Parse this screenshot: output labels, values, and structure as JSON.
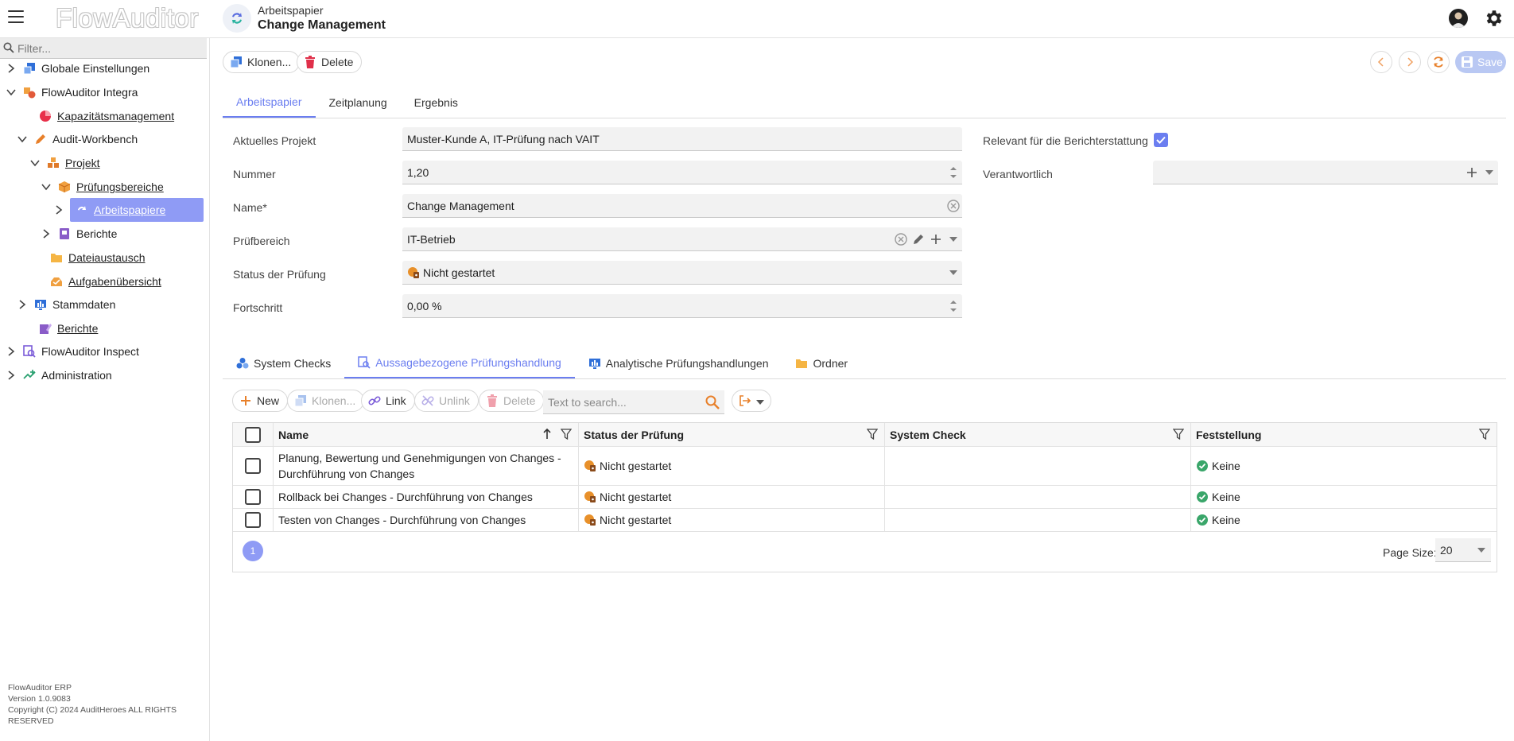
{
  "app": {
    "logo": "FlowAuditor"
  },
  "header": {
    "subtitle": "Arbeitspapier",
    "title": "Change Management"
  },
  "sidebar": {
    "filter_placeholder": "Filter...",
    "items": [
      {
        "label": "Globale Einstellungen"
      },
      {
        "label": "FlowAuditor Integra"
      },
      {
        "label": "Kapazitätsmanagement"
      },
      {
        "label": "Audit-Workbench"
      },
      {
        "label": "Projekt"
      },
      {
        "label": "Prüfungsbereiche"
      },
      {
        "label": "Arbeitspapiere"
      },
      {
        "label": "Berichte"
      },
      {
        "label": "Dateiaustausch"
      },
      {
        "label": "Aufgabenübersicht"
      },
      {
        "label": "Stammdaten"
      },
      {
        "label": "Berichte"
      },
      {
        "label": "FlowAuditor Inspect"
      },
      {
        "label": "Administration"
      }
    ],
    "footer": {
      "line1": "FlowAuditor ERP",
      "line2": "Version 1.0.9083",
      "line3": "Copyright (C) 2024 AuditHeroes ALL RIGHTS RESERVED"
    }
  },
  "toolbar": {
    "clone_label": "Klonen...",
    "delete_label": "Delete",
    "save_label": "Save"
  },
  "tabs": [
    "Arbeitspapier",
    "Zeitplanung",
    "Ergebnis"
  ],
  "form": {
    "project_label": "Aktuelles Projekt",
    "project_value": "Muster-Kunde A, IT-Prüfung nach VAIT",
    "number_label": "Nummer",
    "number_value": "1,20",
    "name_label": "Name*",
    "name_value": "Change Management",
    "area_label": "Prüfbereich",
    "area_value": "IT-Betrieb",
    "status_label": "Status der Prüfung",
    "status_value": "Nicht gestartet",
    "progress_label": "Fortschritt",
    "progress_value": "0,00 %",
    "reporting_label": "Relevant für die Berichterstattung",
    "reporting_checked": true,
    "responsible_label": "Verantwortlich",
    "responsible_value": ""
  },
  "subtabs": [
    "System Checks",
    "Aussagebezogene Prüfungshandlung",
    "Analytische Prüfungshandlungen",
    "Ordner"
  ],
  "grid_toolbar": {
    "new_label": "New",
    "clone_label": "Klonen...",
    "link_label": "Link",
    "unlink_label": "Unlink",
    "delete_label": "Delete",
    "search_placeholder": "Text to search..."
  },
  "grid": {
    "columns": [
      "Name",
      "Status der Prüfung",
      "System Check",
      "Feststellung"
    ],
    "rows": [
      {
        "name_line1": "Planung, Bewertung und Genehmigungen von Changes -",
        "name_line2": "Durchführung von Changes",
        "status": "Nicht gestartet",
        "system_check": "",
        "finding": "Keine"
      },
      {
        "name_line1": "Rollback bei Changes - Durchführung von Changes",
        "name_line2": "",
        "status": "Nicht gestartet",
        "system_check": "",
        "finding": "Keine"
      },
      {
        "name_line1": "Testen von Changes - Durchführung von Changes",
        "name_line2": "",
        "status": "Nicht gestartet",
        "system_check": "",
        "finding": "Keine"
      }
    ],
    "page": "1",
    "page_size_label": "Page Size:",
    "page_size": "20"
  },
  "colors": {
    "accent": "#6b7ef0",
    "selected": "#8f9bf5",
    "status_orange": "#e08a2a",
    "ok_green": "#3aa66a"
  }
}
